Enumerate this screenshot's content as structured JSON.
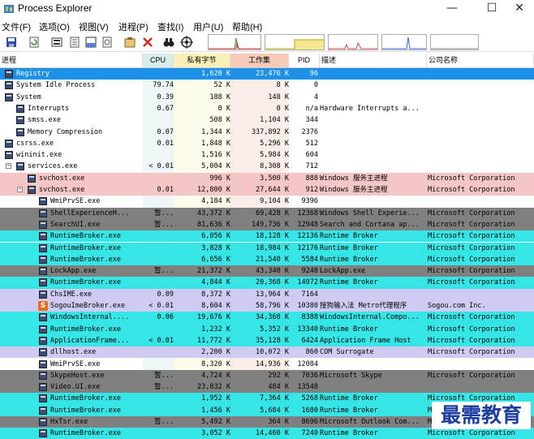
{
  "window": {
    "title": "Process Explorer",
    "minimize": "—",
    "maximize": "☐",
    "close": "✕"
  },
  "menu": [
    "文件(F)",
    "选项(O)",
    "视图(V)",
    "进程(P)",
    "查找(I)",
    "用户(U)",
    "帮助(H)"
  ],
  "columns": {
    "name": "进程",
    "cpu": "CPU",
    "private_bytes": "私有字节",
    "working_set": "工作集",
    "pid": "PID",
    "description": "描述",
    "company": "公司名称"
  },
  "colors": {
    "selected": "#1e90e8",
    "services": "#f6c6c6",
    "immersive": "#36e6e6",
    "suspended": "#808080",
    "own_process": "#d0cbf2",
    "normal": "#ffffff"
  },
  "watermark": "最需教育",
  "processes": [
    {
      "name": "Registry",
      "indent": 1,
      "toggle": "",
      "cpu": "",
      "priv": "1,620 K",
      "ws": "23,476 K",
      "pid": "96",
      "desc": "",
      "comp": "",
      "color": "selected"
    },
    {
      "name": "System Idle Process",
      "indent": 1,
      "toggle": "",
      "cpu": "79.74",
      "priv": "52 K",
      "ws": "8 K",
      "pid": "0",
      "desc": "",
      "comp": "",
      "color": "normal"
    },
    {
      "name": "System",
      "indent": 1,
      "toggle": "-",
      "cpu": "0.39",
      "priv": "188 K",
      "ws": "148 K",
      "pid": "4",
      "desc": "",
      "comp": "",
      "color": "normal"
    },
    {
      "name": "Interrupts",
      "indent": 3,
      "toggle": "",
      "cpu": "0.67",
      "priv": "0 K",
      "ws": "0 K",
      "pid": "n/a",
      "desc": "Hardware Interrupts a...",
      "comp": "",
      "color": "normal"
    },
    {
      "name": "smss.exe",
      "indent": 3,
      "toggle": "",
      "cpu": "",
      "priv": "508 K",
      "ws": "1,104 K",
      "pid": "344",
      "desc": "",
      "comp": "",
      "color": "normal"
    },
    {
      "name": "Memory Compression",
      "indent": 3,
      "toggle": "",
      "cpu": "0.07",
      "priv": "1,344 K",
      "ws": "337,892 K",
      "pid": "2376",
      "desc": "",
      "comp": "",
      "color": "normal"
    },
    {
      "name": "csrss.exe",
      "indent": 1,
      "toggle": "",
      "cpu": "0.01",
      "priv": "1,848 K",
      "ws": "5,296 K",
      "pid": "512",
      "desc": "",
      "comp": "",
      "color": "normal"
    },
    {
      "name": "wininit.exe",
      "indent": 1,
      "toggle": "-",
      "cpu": "",
      "priv": "1,516 K",
      "ws": "5,984 K",
      "pid": "604",
      "desc": "",
      "comp": "",
      "color": "normal"
    },
    {
      "name": "services.exe",
      "indent": 3,
      "toggle": "-",
      "cpu": "< 0.01",
      "priv": "5,004 K",
      "ws": "8,308 K",
      "pid": "712",
      "desc": "",
      "comp": "",
      "color": "normal"
    },
    {
      "name": "svchost.exe",
      "indent": 5,
      "toggle": "",
      "cpu": "",
      "priv": "996 K",
      "ws": "3,500 K",
      "pid": "888",
      "desc": "Windows 服务主进程",
      "comp": "Microsoft Corporation",
      "color": "services"
    },
    {
      "name": "svchost.exe",
      "indent": 5,
      "toggle": "-",
      "cpu": "0.01",
      "priv": "12,800 K",
      "ws": "27,644 K",
      "pid": "912",
      "desc": "Windows 服务主进程",
      "comp": "Microsoft Corporation",
      "color": "services"
    },
    {
      "name": "WmiPrvSE.exe",
      "indent": 7,
      "toggle": "",
      "cpu": "",
      "priv": "4,184 K",
      "ws": "9,104 K",
      "pid": "9396",
      "desc": "",
      "comp": "",
      "color": "normal"
    },
    {
      "name": "ShellExperienceH...",
      "indent": 7,
      "toggle": "",
      "cpu": "暂...",
      "priv": "43,372 K",
      "ws": "69,428 K",
      "pid": "12368",
      "desc": "Windows Shell Experie...",
      "comp": "Microsoft Corporation",
      "color": "suspended"
    },
    {
      "name": "SearchUI.exe",
      "indent": 7,
      "toggle": "",
      "cpu": "暂...",
      "priv": "81,636 K",
      "ws": "149,736 K",
      "pid": "12948",
      "desc": "Search and Cortana ap...",
      "comp": "Microsoft Corporation",
      "color": "suspended"
    },
    {
      "name": "RuntimeBroker.exe",
      "indent": 7,
      "toggle": "",
      "cpu": "",
      "priv": "6,056 K",
      "ws": "18,128 K",
      "pid": "12136",
      "desc": "Runtime Broker",
      "comp": "Microsoft Corporation",
      "color": "immersive"
    },
    {
      "name": "RuntimeBroker.exe",
      "indent": 7,
      "toggle": "",
      "cpu": "",
      "priv": "3,828 K",
      "ws": "18,984 K",
      "pid": "12176",
      "desc": "Runtime Broker",
      "comp": "Microsoft Corporation",
      "color": "immersive"
    },
    {
      "name": "RuntimeBroker.exe",
      "indent": 7,
      "toggle": "",
      "cpu": "",
      "priv": "6,656 K",
      "ws": "21,540 K",
      "pid": "5584",
      "desc": "Runtime Broker",
      "comp": "Microsoft Corporation",
      "color": "immersive"
    },
    {
      "name": "LockApp.exe",
      "indent": 7,
      "toggle": "",
      "cpu": "暂...",
      "priv": "21,372 K",
      "ws": "43,340 K",
      "pid": "9240",
      "desc": "LockApp.exe",
      "comp": "Microsoft Corporation",
      "color": "suspended"
    },
    {
      "name": "RuntimeBroker.exe",
      "indent": 7,
      "toggle": "",
      "cpu": "",
      "priv": "4,844 K",
      "ws": "20,368 K",
      "pid": "14072",
      "desc": "Runtime Broker",
      "comp": "Microsoft Corporation",
      "color": "immersive"
    },
    {
      "name": "ChsIME.exe",
      "indent": 7,
      "toggle": "",
      "cpu": "0.09",
      "priv": "8,372 K",
      "ws": "13,964 K",
      "pid": "7164",
      "desc": "",
      "comp": "",
      "color": "own_process"
    },
    {
      "name": "SogouImeBroker.exe",
      "indent": 7,
      "toggle": "",
      "cpu": "< 0.01",
      "priv": "8,604 K",
      "ws": "58,796 K",
      "pid": "10380",
      "desc": "搜狗输入法 Metro代理程序",
      "comp": "Sogou.com Inc.",
      "color": "own_process",
      "sogou": true
    },
    {
      "name": "WindowsInternal....",
      "indent": 7,
      "toggle": "",
      "cpu": "0.06",
      "priv": "19,676 K",
      "ws": "34,368 K",
      "pid": "8388",
      "desc": "WindowsInternal.Compo...",
      "comp": "Microsoft Corporation",
      "color": "immersive"
    },
    {
      "name": "RuntimeBroker.exe",
      "indent": 7,
      "toggle": "",
      "cpu": "",
      "priv": "1,232 K",
      "ws": "5,352 K",
      "pid": "13340",
      "desc": "Runtime Broker",
      "comp": "Microsoft Corporation",
      "color": "immersive"
    },
    {
      "name": "ApplicationFrame...",
      "indent": 7,
      "toggle": "",
      "cpu": "< 0.01",
      "priv": "11,772 K",
      "ws": "35,128 K",
      "pid": "6424",
      "desc": "Application Frame Host",
      "comp": "Microsoft Corporation",
      "color": "immersive"
    },
    {
      "name": "dllhost.exe",
      "indent": 7,
      "toggle": "",
      "cpu": "",
      "priv": "2,200 K",
      "ws": "10,072 K",
      "pid": "860",
      "desc": "COM Surrogate",
      "comp": "Microsoft Corporation",
      "color": "own_process"
    },
    {
      "name": "WmiPrvSE.exe",
      "indent": 7,
      "toggle": "",
      "cpu": "",
      "priv": "8,320 K",
      "ws": "14,936 K",
      "pid": "12084",
      "desc": "",
      "comp": "",
      "color": "normal"
    },
    {
      "name": "SkypeHost.exe",
      "indent": 7,
      "toggle": "",
      "cpu": "暂...",
      "priv": "4,724 K",
      "ws": "292 K",
      "pid": "7036",
      "desc": "Microsoft Skype",
      "comp": "Microsoft Corporation",
      "color": "suspended"
    },
    {
      "name": "Video.UI.exe",
      "indent": 7,
      "toggle": "",
      "cpu": "暂...",
      "priv": "23,832 K",
      "ws": "484 K",
      "pid": "13548",
      "desc": "",
      "comp": "",
      "color": "suspended"
    },
    {
      "name": "RuntimeBroker.exe",
      "indent": 7,
      "toggle": "",
      "cpu": "",
      "priv": "1,952 K",
      "ws": "7,364 K",
      "pid": "5268",
      "desc": "Runtime Broker",
      "comp": "Microsoft Corporation",
      "color": "immersive"
    },
    {
      "name": "RuntimeBroker.exe",
      "indent": 7,
      "toggle": "",
      "cpu": "",
      "priv": "1,456 K",
      "ws": "5,684 K",
      "pid": "1680",
      "desc": "Runtime Broker",
      "comp": "Microsoft Corporation",
      "color": "immersive"
    },
    {
      "name": "HxTsr.exe",
      "indent": 7,
      "toggle": "",
      "cpu": "暂...",
      "priv": "5,492 K",
      "ws": "364 K",
      "pid": "8696",
      "desc": "Microsoft Outlook Com...",
      "comp": "Microsoft Corporation",
      "color": "suspended"
    },
    {
      "name": "RuntimeBroker.exe",
      "indent": 7,
      "toggle": "",
      "cpu": "",
      "priv": "3,052 K",
      "ws": "14,460 K",
      "pid": "7240",
      "desc": "Runtime Broker",
      "comp": "Microsoft Corporation",
      "color": "immersive"
    }
  ]
}
